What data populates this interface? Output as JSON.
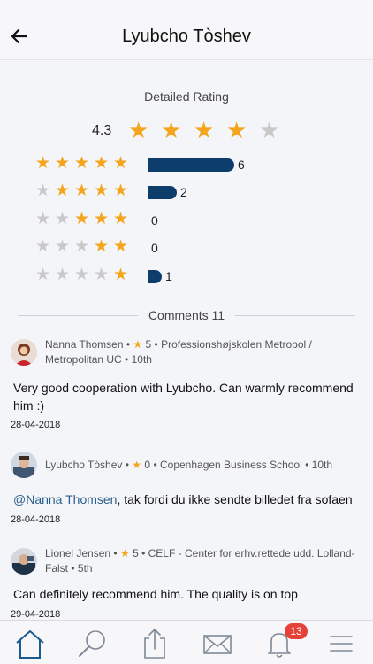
{
  "header": {
    "title": "Lyubcho Tòshev"
  },
  "detailed": {
    "title": "Detailed Rating",
    "overall_value": "4.3",
    "overall_stars_filled": 4,
    "distribution": [
      {
        "stars": 5,
        "count": "6",
        "fraction": 1.0
      },
      {
        "stars": 4,
        "count": "2",
        "fraction": 0.333
      },
      {
        "stars": 3,
        "count": "0",
        "fraction": 0
      },
      {
        "stars": 2,
        "count": "0",
        "fraction": 0
      },
      {
        "stars": 1,
        "count": "1",
        "fraction": 0.167
      }
    ]
  },
  "comments": {
    "title": "Comments 11",
    "items": [
      {
        "author": "Nanna Thomsen",
        "rating": "5",
        "school_line1": "Professionshøjskolen Metropol /",
        "school_line2": "Metropolitan UC",
        "semester": "10th",
        "text": "Very good cooperation with Lyubcho. Can warmly recommend him :)",
        "date": "28-04-2018"
      },
      {
        "author": "Lyubcho Tòshev",
        "rating": "0",
        "school_line1": "Copenhagen Business School",
        "semester": "10th",
        "mention": "@Nanna Thomsen",
        "text": ", tak fordi du ikke sendte billedet fra sofaen",
        "date": "28-04-2018"
      },
      {
        "author": "Lionel Jensen",
        "rating": "5",
        "school_line1": "CELF - Center for erhv.rettede udd.",
        "school_line2": "Lolland-Falst",
        "semester": "5th",
        "text": "Can definitely recommend him. The quality is on top",
        "date": "29-04-2018"
      }
    ]
  },
  "tabbar": {
    "items": [
      "home-icon",
      "search-icon",
      "share-icon",
      "mail-icon",
      "bell-icon",
      "menu-icon"
    ],
    "notifications_badge": "13",
    "active": "home-icon"
  },
  "colors": {
    "star_gold": "#f4a51c",
    "bar_navy": "#0d3d6a",
    "badge_red": "#e5403a",
    "accent_blue": "#2a5e8c"
  }
}
